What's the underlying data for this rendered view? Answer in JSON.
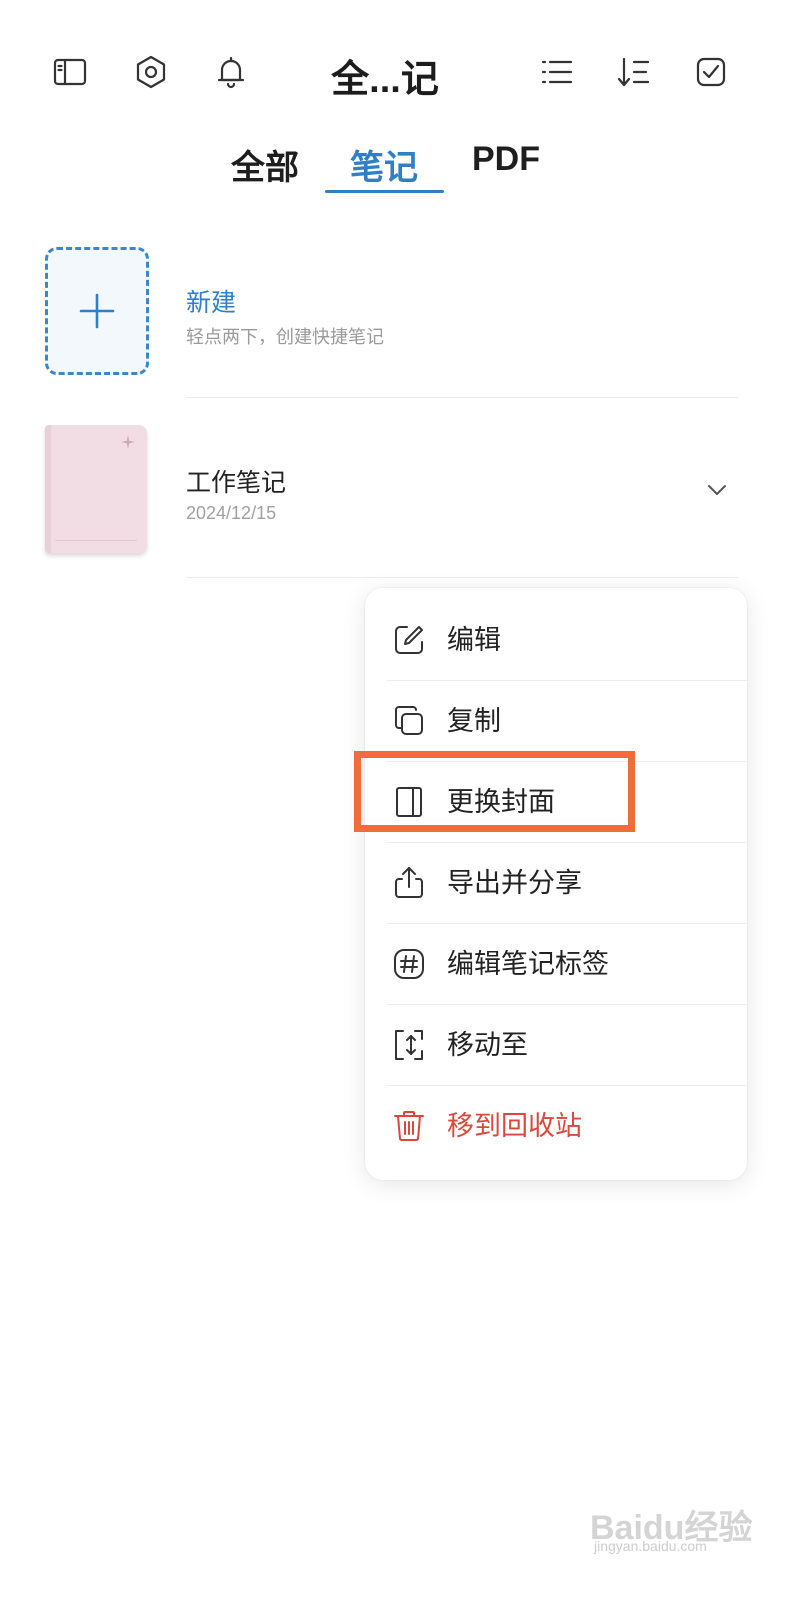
{
  "header": {
    "title": "全...记",
    "left_icons": [
      "sidebar-panel-icon",
      "settings-hex-icon",
      "bell-icon"
    ],
    "right_icons": [
      "list-view-icon",
      "sort-icon",
      "multi-select-icon"
    ]
  },
  "tabs": [
    {
      "label": "全部",
      "active": false
    },
    {
      "label": "笔记",
      "active": true
    },
    {
      "label": "PDF",
      "active": false
    }
  ],
  "new_note": {
    "title": "新建",
    "subtitle": "轻点两下，创建快捷笔记"
  },
  "notes": [
    {
      "title": "工作笔记",
      "date": "2024/12/15",
      "cover_color": "#f2dde4"
    }
  ],
  "context_menu": {
    "items": [
      {
        "label": "编辑",
        "icon": "edit-icon"
      },
      {
        "label": "复制",
        "icon": "copy-icon"
      },
      {
        "label": "更换封面",
        "icon": "cover-icon",
        "highlighted": true
      },
      {
        "label": "导出并分享",
        "icon": "share-icon"
      },
      {
        "label": "编辑笔记标签",
        "icon": "hashtag-icon"
      },
      {
        "label": "移动至",
        "icon": "move-icon"
      },
      {
        "label": "移到回收站",
        "icon": "trash-icon",
        "danger": true
      }
    ]
  },
  "colors": {
    "accent": "#2f7fc8",
    "danger": "#d9483b",
    "highlight_box": "#f36b3a"
  },
  "watermark": {
    "main": "Baidu经验",
    "sub": "jingyan.baidu.com"
  }
}
